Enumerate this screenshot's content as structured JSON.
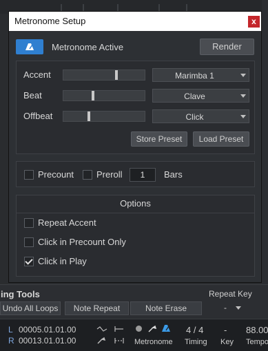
{
  "window": {
    "title": "Metronome Setup",
    "close": "x"
  },
  "header": {
    "active_label": "Metronome Active",
    "render_label": "Render"
  },
  "sounds": [
    {
      "label": "Accent",
      "value": 0.65,
      "sound": "Marimba 1"
    },
    {
      "label": "Beat",
      "value": 0.35,
      "sound": "Clave"
    },
    {
      "label": "Offbeat",
      "value": 0.3,
      "sound": "Click"
    }
  ],
  "presets": {
    "store_label": "Store Preset",
    "load_label": "Load Preset"
  },
  "countin": {
    "precount_label": "Precount",
    "preroll_label": "Preroll",
    "bars_value": "1",
    "bars_label": "Bars"
  },
  "options": {
    "header": "Options",
    "items": [
      {
        "label": "Repeat Accent",
        "checked": false
      },
      {
        "label": "Click in Precount Only",
        "checked": false
      },
      {
        "label": "Click in Play",
        "checked": true
      }
    ]
  },
  "tools": {
    "title": "ing Tools",
    "repeat_key_label": "Repeat Key",
    "undo_label": "Undo All Loops",
    "note_repeat_label": "Note Repeat",
    "note_erase_label": "Note Erase",
    "key_value": "-"
  },
  "transport": {
    "left_marker": "L",
    "left_time": "00005.01.01.00",
    "right_marker": "R",
    "right_time": "00013.01.01.00",
    "metronome_label": "Metronome",
    "timing_value": "4 / 4",
    "timing_label": "Timing",
    "key_value": "-",
    "key_label": "Key",
    "tempo_value": "88.00",
    "tempo_label": "Tempo"
  },
  "colors": {
    "accent_blue": "#2f7fd0",
    "close_red": "#c4262b"
  }
}
